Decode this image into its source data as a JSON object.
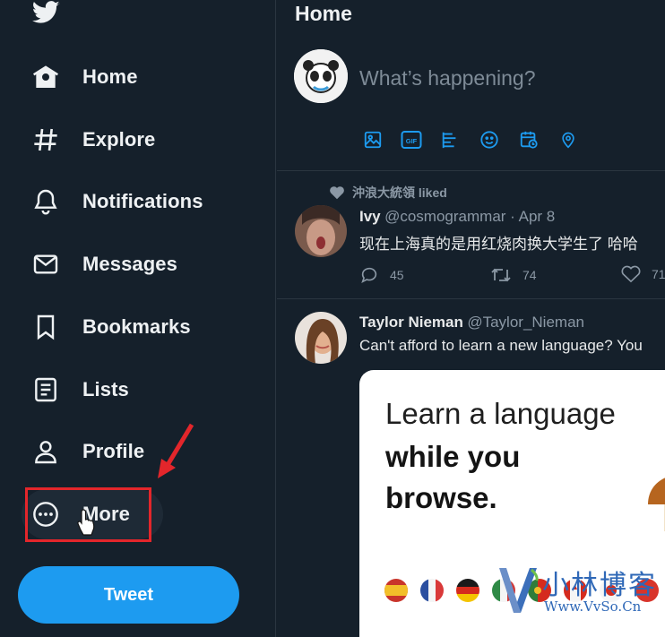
{
  "sidebar": {
    "logo_icon": "twitter-bird-icon",
    "items": [
      {
        "label": "Home",
        "icon": "home-icon"
      },
      {
        "label": "Explore",
        "icon": "hashtag-icon"
      },
      {
        "label": "Notifications",
        "icon": "bell-icon"
      },
      {
        "label": "Messages",
        "icon": "envelope-icon"
      },
      {
        "label": "Bookmarks",
        "icon": "bookmark-icon"
      },
      {
        "label": "Lists",
        "icon": "list-icon"
      },
      {
        "label": "Profile",
        "icon": "person-icon"
      },
      {
        "label": "More",
        "icon": "more-circle-icon"
      }
    ],
    "tweet_button": "Tweet"
  },
  "main": {
    "title": "Home",
    "composer": {
      "placeholder": "What’s happening?",
      "tools": [
        "image-icon",
        "gif-icon",
        "poll-icon",
        "emoji-icon",
        "schedule-icon",
        "location-icon"
      ]
    },
    "tweets": [
      {
        "liked_by": "沖浪大統領 liked",
        "name": "Ivy",
        "handle_date": "@cosmogrammar · Apr 8",
        "text": "现在上海真的是用红烧肉换大学生了 哈哈",
        "replies": "45",
        "retweets": "74",
        "likes": "71"
      },
      {
        "name": "Taylor Nieman",
        "handle": "@Taylor_Nieman",
        "text": "Can't afford to learn a new language? You",
        "card": {
          "line1": "Learn a language",
          "line2": "while you",
          "line3": "browse."
        }
      }
    ]
  },
  "watermark": {
    "title": "小林博客",
    "url": "Www.VvSo.Cn"
  },
  "colors": {
    "background": "#15202b",
    "accent": "#1d9bf0",
    "highlight": "#e3262b"
  }
}
